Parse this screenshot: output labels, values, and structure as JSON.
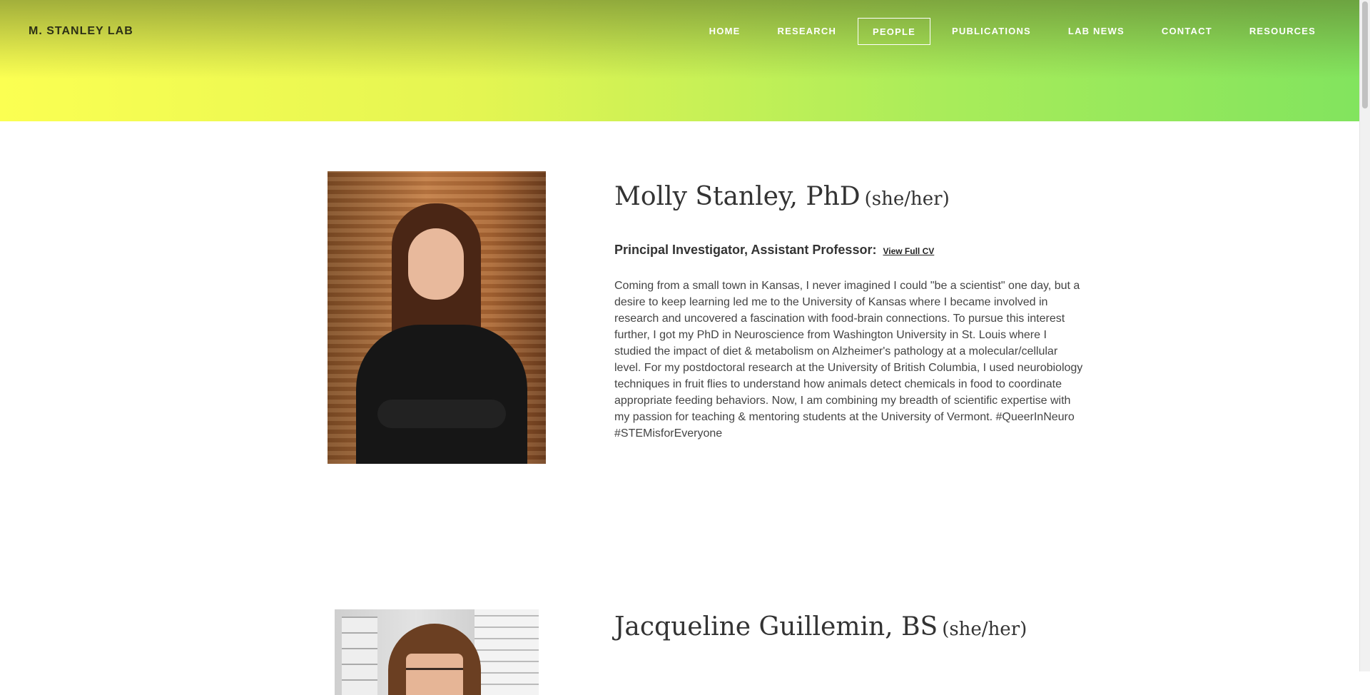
{
  "site": {
    "logo": "M. STANLEY LAB"
  },
  "nav": {
    "items": [
      {
        "label": "HOME"
      },
      {
        "label": "RESEARCH"
      },
      {
        "label": "PEOPLE"
      },
      {
        "label": "PUBLICATIONS"
      },
      {
        "label": "LAB NEWS"
      },
      {
        "label": "CONTACT"
      },
      {
        "label": "RESOURCES"
      }
    ],
    "active": "PEOPLE"
  },
  "people": [
    {
      "name": "Molly Stanley, PhD",
      "pronouns": "(she/her)",
      "role": "Principal Investigator, Assistant Professor:",
      "cv_link": "View Full CV",
      "bio": "Coming from a small town in Kansas, I never imagined I could \"be a scientist\" one day, but a desire to keep learning led me to the University of Kansas where I became involved in research and uncovered a fascination with food-brain connections. To pursue this interest further, I got my PhD in Neuroscience from Washington University in St. Louis where I studied the impact of diet & metabolism on Alzheimer's pathology at a molecular/cellular level. For my postdoctoral research at the University of British Columbia, I used neurobiology techniques in fruit flies to understand how animals detect chemicals in food to coordinate appropriate feeding behaviors. Now, I am combining my breadth of scientific expertise with my passion for teaching & mentoring students at the University of Vermont. #QueerInNeuro #STEMisforEveryone"
    },
    {
      "name": "Jacqueline Guillemin, BS",
      "pronouns": "(she/her)"
    }
  ],
  "colors": {
    "banner_left": "#fbff52",
    "banner_right": "#82e45e",
    "nav_text": "#ffffff"
  }
}
